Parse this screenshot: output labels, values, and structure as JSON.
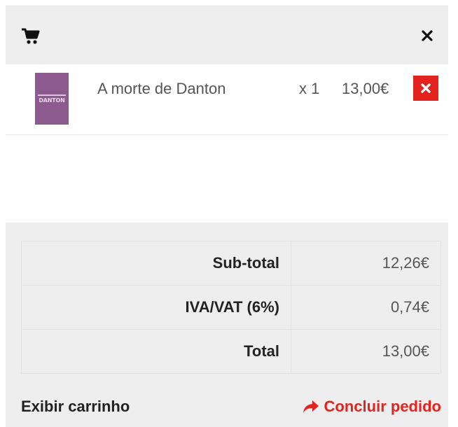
{
  "colors": {
    "accent_red": "#e4231f",
    "panel_gray": "#eeeeee",
    "text_dark": "#222222",
    "text_muted": "#555555"
  },
  "header": {
    "cart_icon": "shopping-cart-icon",
    "close_icon": "close-icon"
  },
  "items": [
    {
      "thumbnail_text": "DANTON",
      "name": "A morte de Danton",
      "quantity": "x 1",
      "price": "13,00€",
      "remove_icon": "close-icon"
    }
  ],
  "totals": [
    {
      "label": "Sub-total",
      "value": "12,26€"
    },
    {
      "label": "IVA/VAT (6%)",
      "value": "0,74€"
    },
    {
      "label": "Total",
      "value": "13,00€"
    }
  ],
  "actions": {
    "view_cart_label": "Exibir carrinho",
    "checkout_label": "Concluir pedido",
    "checkout_icon": "share-arrow-icon"
  }
}
